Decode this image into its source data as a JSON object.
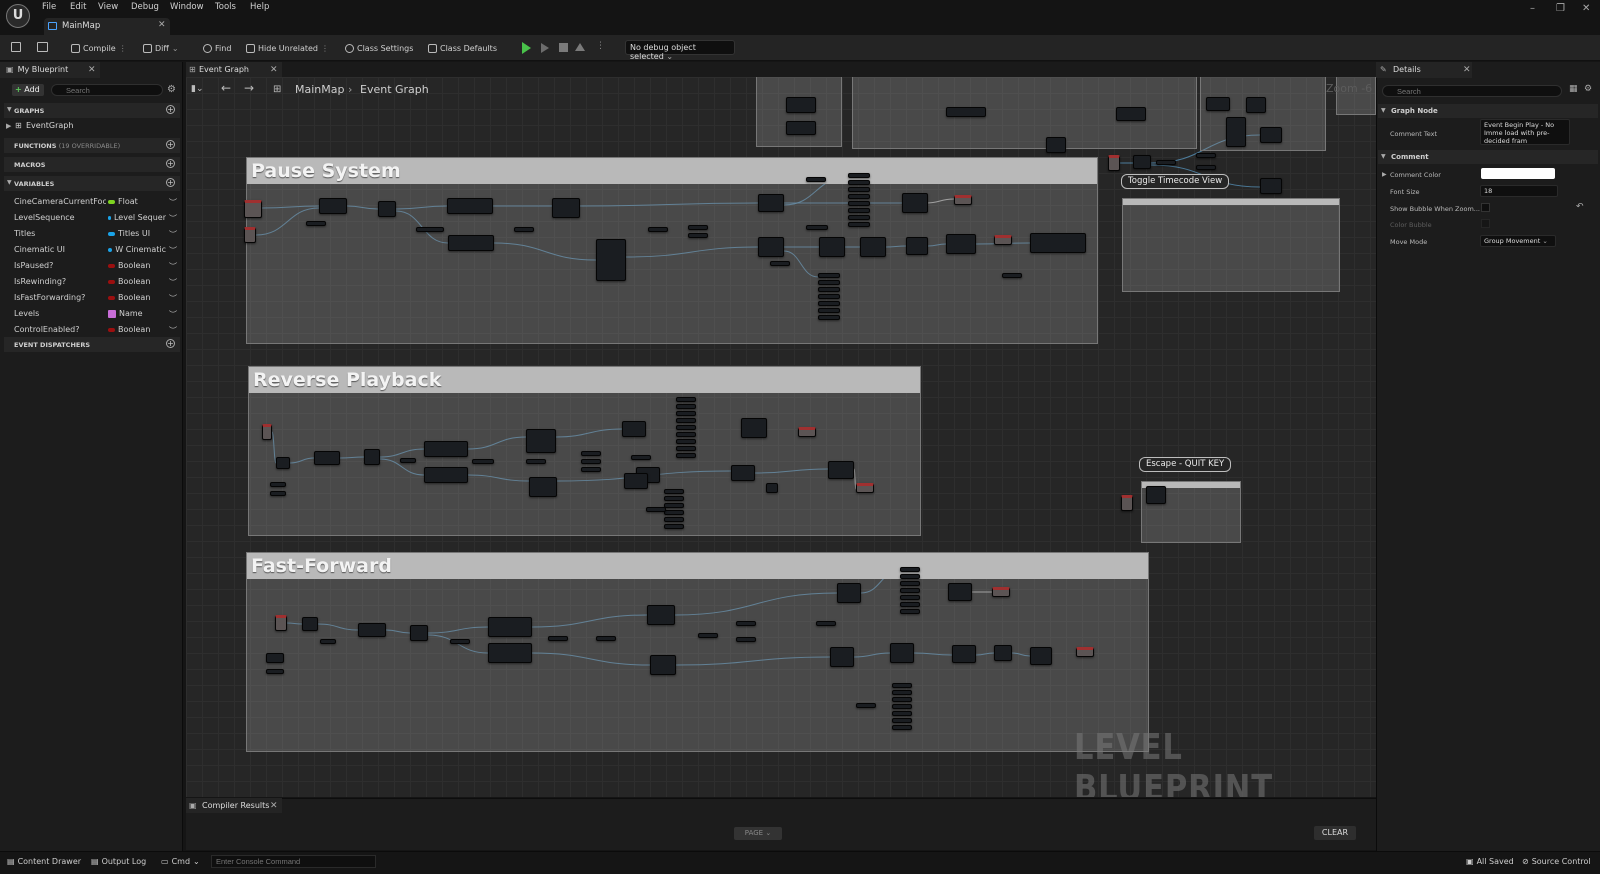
{
  "menu": [
    "File",
    "Edit",
    "View",
    "Debug",
    "Window",
    "Tools",
    "Help"
  ],
  "document_tab": "MainMap",
  "toolbar": {
    "compile": "Compile",
    "diff": "Diff",
    "find": "Find",
    "hide_unrelated": "Hide Unrelated",
    "class_settings": "Class Settings",
    "class_defaults": "Class Defaults",
    "debug_object": "No debug object selected"
  },
  "my_blueprint": {
    "tab": "My Blueprint",
    "add": "Add",
    "search_placeholder": "Search",
    "sections": {
      "graphs": "GRAPHS",
      "functions": "FUNCTIONS",
      "functions_count": "(19 OVERRIDABLE)",
      "macros": "MACROS",
      "variables": "VARIABLES",
      "event_dispatchers": "EVENT DISPATCHERS"
    },
    "graphs": [
      "EventGraph"
    ],
    "variables": [
      {
        "name": "CineCameraCurrentFoca",
        "type": "Float",
        "color": "#7ed321"
      },
      {
        "name": "LevelSequence",
        "type": "Level Sequer",
        "color": "#1aa3e8"
      },
      {
        "name": "Titles",
        "type": "Titles UI",
        "color": "#1aa3e8"
      },
      {
        "name": "Cinematic UI",
        "type": "W Cinematic",
        "color": "#1aa3e8"
      },
      {
        "name": "IsPaused?",
        "type": "Boolean",
        "color": "#9b0f0f"
      },
      {
        "name": "IsRewinding?",
        "type": "Boolean",
        "color": "#9b0f0f"
      },
      {
        "name": "IsFastForwarding?",
        "type": "Boolean",
        "color": "#9b0f0f"
      },
      {
        "name": "Levels",
        "type": "Name",
        "color": "#c86dd7"
      },
      {
        "name": "ControlEnabled?",
        "type": "Boolean",
        "color": "#9b0f0f"
      }
    ]
  },
  "graph": {
    "tab": "Event Graph",
    "breadcrumb": [
      "MainMap",
      "Event Graph"
    ],
    "zoom": "Zoom -6",
    "comments": [
      "Pause System",
      "Reverse Playback",
      "Fast-Forward"
    ],
    "bubbles": [
      "Toggle Timecode View",
      "Escape - QUIT KEY"
    ],
    "watermark": "LEVEL BLUEPRINT"
  },
  "compiler": {
    "tab": "Compiler Results",
    "page": "PAGE",
    "clear": "CLEAR"
  },
  "details": {
    "tab": "Details",
    "search_placeholder": "Search",
    "section_graph_node": "Graph Node",
    "comment_text_label": "Comment Text",
    "comment_text_value": "Event Begin Play - No Imme load with pre-decided fram",
    "section_comment": "Comment",
    "comment_color_label": "Comment Color",
    "font_size_label": "Font Size",
    "font_size_value": "18",
    "show_bubble_label": "Show Bubble When Zoom...",
    "color_bubble_label": "Color Bubble",
    "move_mode_label": "Move Mode",
    "move_mode_value": "Group Movement"
  },
  "statusbar": {
    "content_drawer": "Content Drawer",
    "output_log": "Output Log",
    "cmd": "Cmd",
    "console_placeholder": "Enter Console Command",
    "all_saved": "All Saved",
    "source_control": "Source Control"
  }
}
